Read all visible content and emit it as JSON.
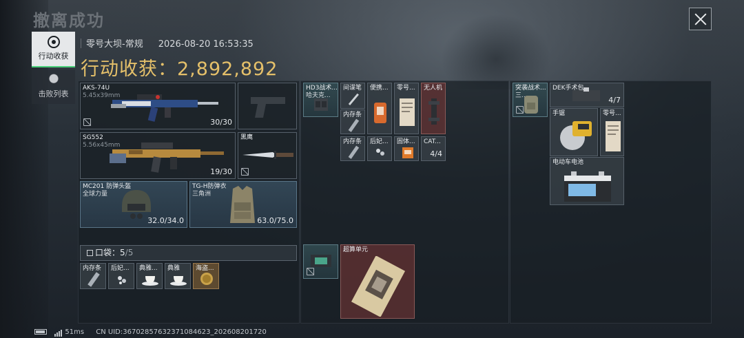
{
  "header": {
    "title": "撤离成功"
  },
  "sidebar": {
    "tabs": [
      {
        "label": "行动收获",
        "icon": "record-icon"
      },
      {
        "label": "击败列表",
        "icon": "skull-icon"
      }
    ]
  },
  "raid": {
    "map": "零号大坝-常规",
    "datetime": "2026-08-20 16:53:35",
    "loot_label": "行动收获：",
    "loot_value": "2,892,892"
  },
  "equipment": {
    "primary": {
      "name": "AKS-74U",
      "ammo": "5.45x39mm",
      "count": "30/30"
    },
    "sidearm": {
      "name": "",
      "count": ""
    },
    "secondary": {
      "name": "SG552",
      "ammo": "5.56x45mm",
      "count": "19/30"
    },
    "melee": {
      "name": "黑鹰"
    },
    "helmet": {
      "name": "MC201 防弹头盔",
      "brand": "全球力量",
      "durability": "32.0/34.0"
    },
    "armor": {
      "name": "TG-H防弹衣",
      "brand": "三角洲",
      "durability": "63.0/75.0"
    }
  },
  "pocket": {
    "label": "口袋：",
    "used": "5",
    "capacity": "/5",
    "items": [
      {
        "name": "内存条"
      },
      {
        "name": "后妃..."
      },
      {
        "name": "典雅..."
      },
      {
        "name": "典雅"
      },
      {
        "name": "海盗..."
      }
    ]
  },
  "chest_rig": {
    "name": "HD3战术...",
    "sub": "哈夫克...",
    "items": [
      {
        "name": "间谍笔"
      },
      {
        "name": "便携..."
      },
      {
        "name": "零号..."
      },
      {
        "name": "无人机"
      },
      {
        "name": "内存条"
      },
      {
        "name": "内存条"
      },
      {
        "name": "后妃..."
      },
      {
        "name": "固体..."
      },
      {
        "name": "CAT...",
        "count": "4/4"
      }
    ]
  },
  "case": {
    "name": "",
    "items": [
      {
        "name": "超算单元"
      }
    ]
  },
  "backpack": {
    "name": "突袭战术...",
    "sub": "三...",
    "items": [
      {
        "name": "DEK手术包",
        "count": "4/7"
      },
      {
        "name": "手锯"
      },
      {
        "name": "零号..."
      },
      {
        "name": "电动车电池"
      }
    ]
  },
  "footer": {
    "ping": "51ms",
    "uid": "CN UID:36702857632371084623_202608201720"
  }
}
